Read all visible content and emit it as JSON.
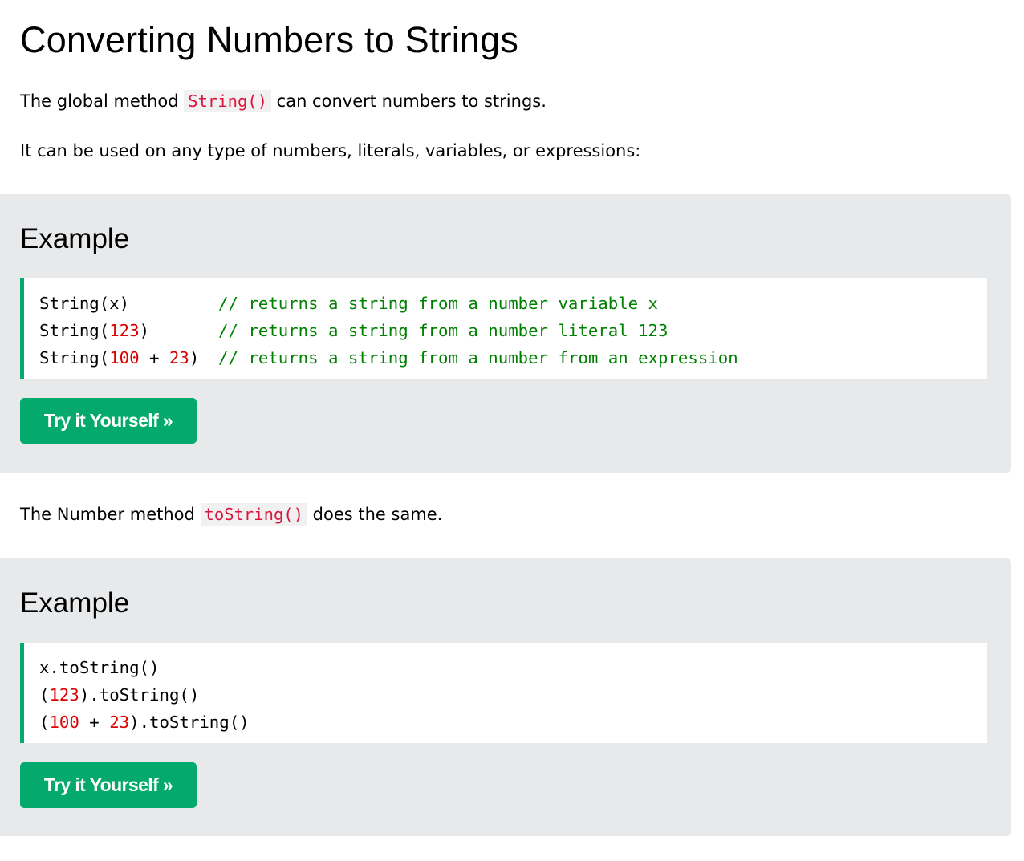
{
  "page": {
    "title": "Converting Numbers to Strings"
  },
  "intro": {
    "p1_before": "The global method ",
    "p1_code": "String()",
    "p1_after": " can convert numbers to strings.",
    "p2": "It can be used on any type of numbers, literals, variables, or expressions:"
  },
  "example1": {
    "heading": "Example",
    "lines": [
      {
        "call_a": "String(x)",
        "call_num1": "",
        "call_b": "",
        "call_num2": "",
        "call_c": "",
        "comment": "// returns a string from a number variable x"
      },
      {
        "call_a": "String(",
        "call_num1": "123",
        "call_b": ")",
        "call_num2": "",
        "call_c": "",
        "comment": "// returns a string from a number literal 123"
      },
      {
        "call_a": "String(",
        "call_num1": "100",
        "call_b": " + ",
        "call_num2": "23",
        "call_c": ")",
        "comment": "// returns a string from a number from an expression"
      }
    ],
    "button_label": "Try it Yourself »"
  },
  "middle": {
    "p_before": "The Number method ",
    "p_code": "toString()",
    "p_after": " does the same."
  },
  "example2": {
    "heading": "Example",
    "lines": [
      {
        "a": "x.toString()",
        "n1": "",
        "b": "",
        "n2": "",
        "c": ""
      },
      {
        "a": "(",
        "n1": "123",
        "b": ").toString()",
        "n2": "",
        "c": ""
      },
      {
        "a": "(",
        "n1": "100",
        "b": " + ",
        "n2": "23",
        "c": ").toString()"
      }
    ],
    "button_label": "Try it Yourself »"
  },
  "colors": {
    "accent_green": "#04aa6d",
    "code_red": "#dc143c",
    "number_red": "#dc0000",
    "comment_green": "#008000",
    "example_bg": "#e7e9eb"
  }
}
